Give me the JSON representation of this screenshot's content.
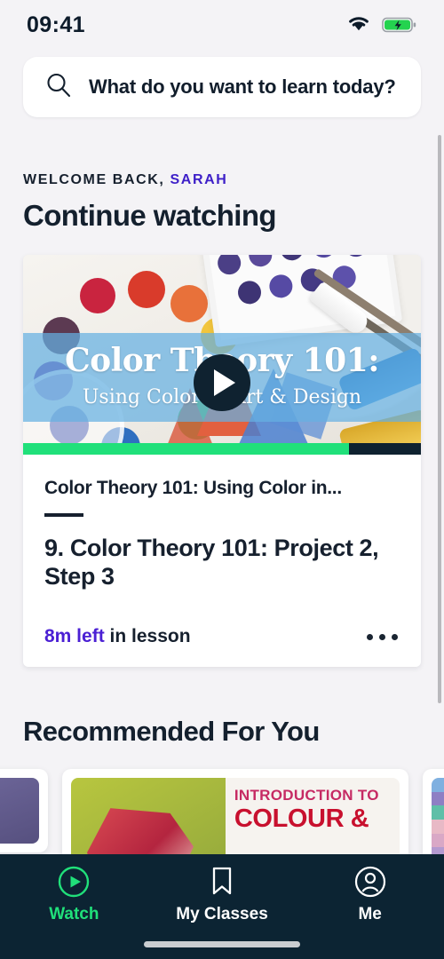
{
  "status_bar": {
    "time": "09:41",
    "wifi_icon": "wifi-icon",
    "battery_icon": "battery-charging-icon",
    "battery_color": "#24d34f"
  },
  "search": {
    "icon": "search-icon",
    "placeholder": "What do you want to learn today?",
    "value": ""
  },
  "header": {
    "welcome_prefix": "WELCOME BACK,",
    "user_name": "SARAH",
    "user_name_color": "#3d1fc8",
    "section_title": "Continue watching"
  },
  "continue_watching": {
    "thumbnail": {
      "overlay_title": "Color Theory 101:",
      "overlay_subtitle": "Using Color in Art & Design",
      "play_icon": "play-icon",
      "progress_percent": 82,
      "progress_color": "#20e07a",
      "track_color": "#0f2230",
      "band_color": "#65b0e2"
    },
    "course_title": "Color Theory 101: Using Color in...",
    "lesson_title": "9. Color Theory 101: Project 2, Step 3",
    "time_left": "8m left",
    "time_left_suffix": " in lesson",
    "time_left_color": "#4b20d4",
    "overflow_icon": "more-options-icon"
  },
  "recommended": {
    "section_title": "Recommended For You",
    "cards": [
      {
        "name": "card-peek-left",
        "thumb_color": "#6c6598",
        "kicker": "",
        "title": ""
      },
      {
        "name": "card-introduction-to-colour",
        "thumb_color": "#b8c63f",
        "kicker": "INTRODUCTION TO",
        "title": "COLOUR &"
      },
      {
        "name": "card-peek-right",
        "thumb_color": "#9ab6d8",
        "kicker": "",
        "title": ""
      }
    ]
  },
  "tab_bar": {
    "background": "#0c2433",
    "active_color": "#20e07a",
    "items": [
      {
        "label": "Watch",
        "icon": "play-circle-icon",
        "active": true
      },
      {
        "label": "My Classes",
        "icon": "bookmark-icon",
        "active": false
      },
      {
        "label": "Me",
        "icon": "person-circle-icon",
        "active": false
      }
    ]
  }
}
